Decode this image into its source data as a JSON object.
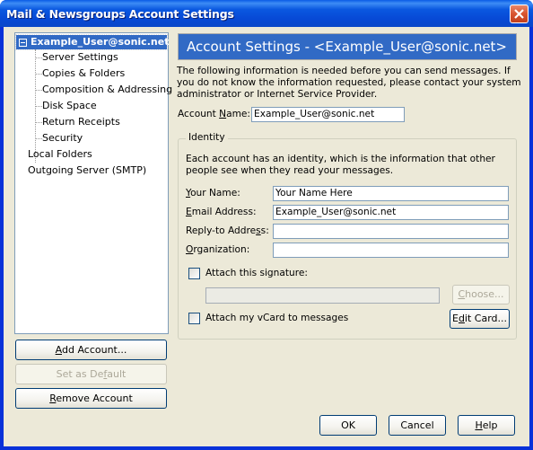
{
  "window": {
    "title": "Mail & Newsgroups Account Settings",
    "close_icon": "close-icon"
  },
  "tree": {
    "account": "Example_User@sonic.net",
    "children": [
      "Server Settings",
      "Copies & Folders",
      "Composition & Addressing",
      "Disk Space",
      "Return Receipts",
      "Security"
    ],
    "others": [
      "Local Folders",
      "Outgoing Server (SMTP)"
    ]
  },
  "left_buttons": {
    "add_account": {
      "pre": "",
      "key": "A",
      "post": "dd Account..."
    },
    "set_default": {
      "pre": "Set as De",
      "key": "f",
      "post": "ault"
    },
    "remove_account": {
      "pre": "",
      "key": "R",
      "post": "emove Account"
    }
  },
  "main": {
    "header": "Account Settings - <Example_User@sonic.net>",
    "description": "The following information is needed before you can send messages. If you do not know the information requested, please contact your system administrator or Internet Service Provider.",
    "account_name": {
      "pre": "Account ",
      "key": "N",
      "post": "ame:",
      "value": "Example_User@sonic.net"
    },
    "identity": {
      "legend": "Identity",
      "description": "Each account has an identity, which is the information that other people see when they read your messages.",
      "your_name": {
        "pre": "",
        "key": "Y",
        "post": "our Name:",
        "value": "Your Name Here"
      },
      "email": {
        "pre": "",
        "key": "E",
        "post": "mail Address:",
        "value": "Example_User@sonic.net"
      },
      "reply_to": {
        "pre": "Reply-to Addre",
        "key": "s",
        "post": "s:",
        "value": ""
      },
      "organization": {
        "pre": "",
        "key": "O",
        "post": "rganization:",
        "value": ""
      },
      "attach_signature": {
        "label": "Attach this signature:",
        "checked": false,
        "path": ""
      },
      "choose": {
        "pre": "",
        "key": "C",
        "post": "hoose..."
      },
      "attach_vcard": {
        "label": "Attach my vCard to messages",
        "checked": false
      },
      "edit_card": {
        "pre": "E",
        "key": "d",
        "post": "it Card..."
      }
    }
  },
  "footer": {
    "ok": "OK",
    "cancel": "Cancel",
    "help": {
      "pre": "",
      "key": "H",
      "post": "elp"
    }
  }
}
